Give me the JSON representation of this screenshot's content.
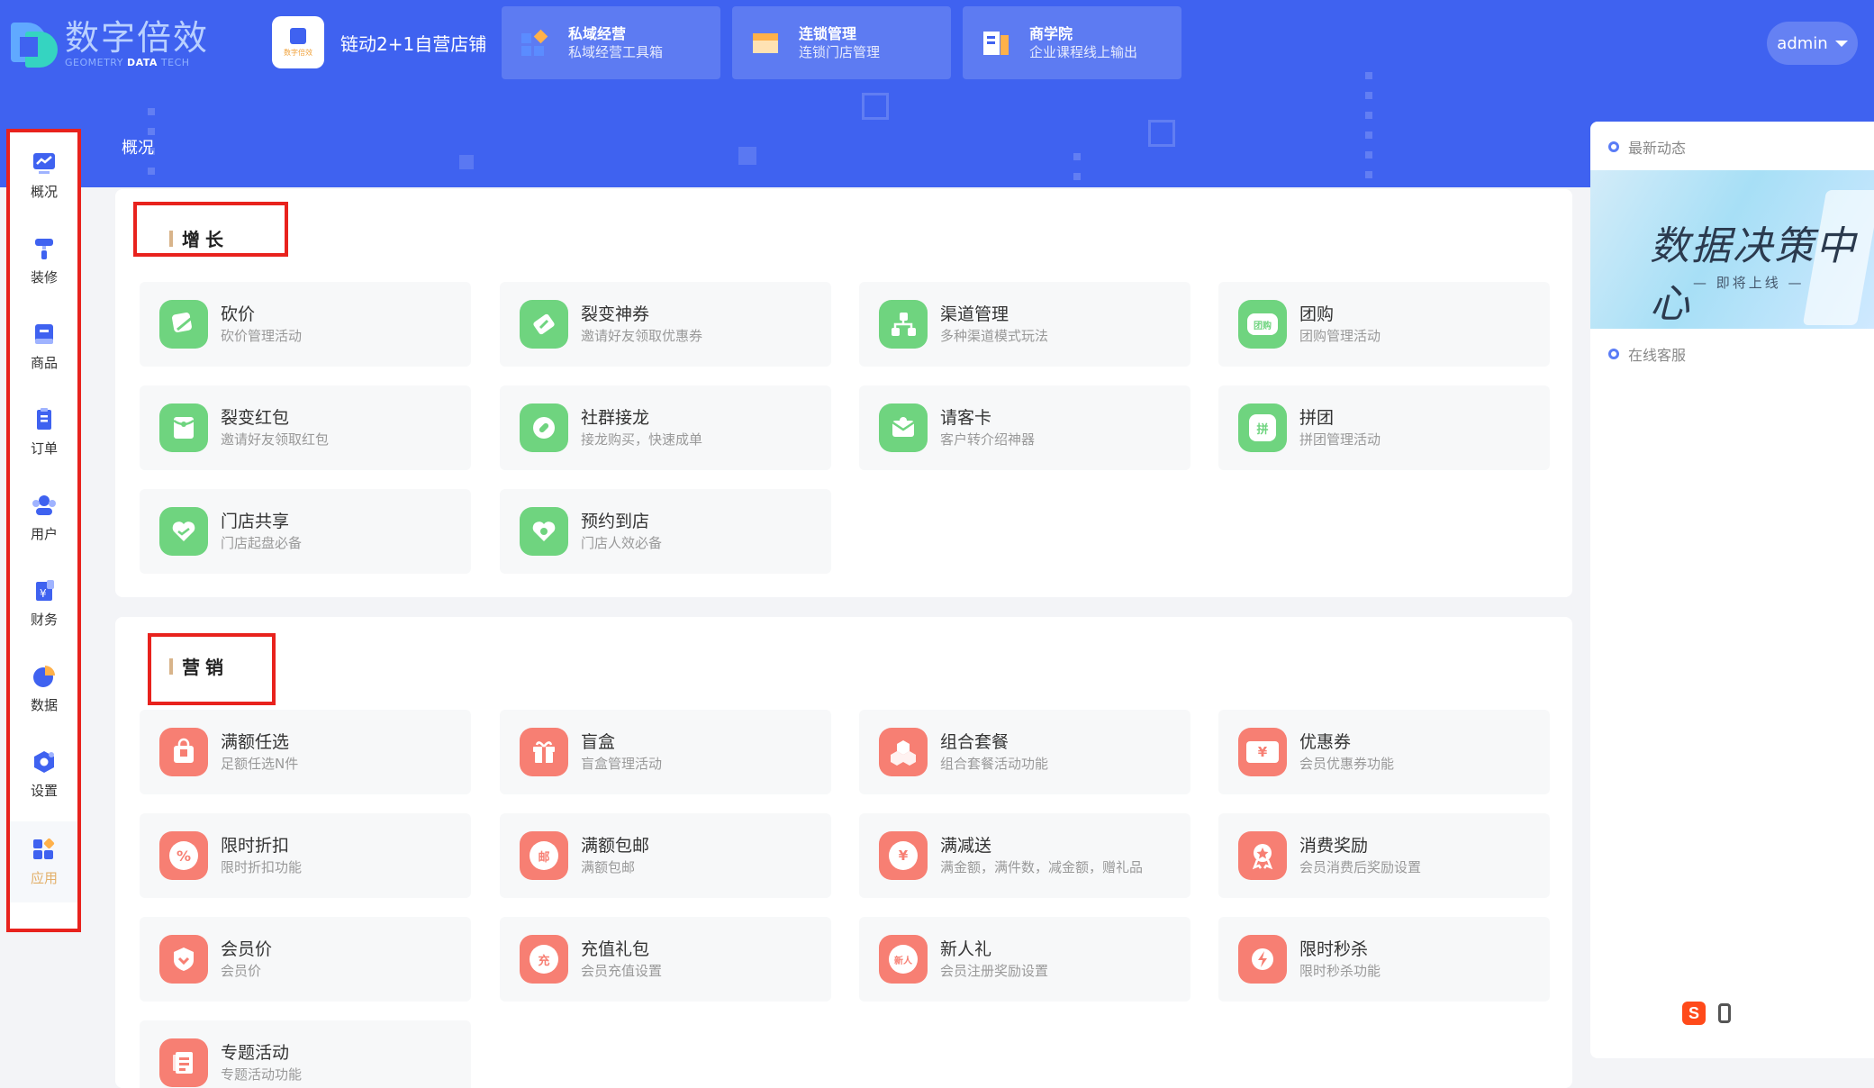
{
  "app": {
    "logo_text": "数字倍效",
    "logo_en_pre": "GEOMETRY ",
    "logo_en_bold": "DATA",
    "logo_en_post": " TECH"
  },
  "shop": {
    "avatar_text": "数字倍效",
    "name": "链动2+1自营店铺"
  },
  "nav_tabs": [
    {
      "title": "私域经营",
      "subtitle": "私域经营工具箱",
      "icon": "grid-icon"
    },
    {
      "title": "连锁管理",
      "subtitle": "连锁门店管理",
      "icon": "store-icon"
    },
    {
      "title": "商学院",
      "subtitle": "企业课程线上输出",
      "icon": "book-icon"
    }
  ],
  "user": {
    "name": "admin"
  },
  "sidebar": {
    "items": [
      {
        "label": "概况",
        "icon": "chart-icon"
      },
      {
        "label": "装修",
        "icon": "paint-roller-icon"
      },
      {
        "label": "商品",
        "icon": "goods-icon"
      },
      {
        "label": "订单",
        "icon": "order-icon"
      },
      {
        "label": "用户",
        "icon": "users-icon"
      },
      {
        "label": "财务",
        "icon": "finance-icon"
      },
      {
        "label": "数据",
        "icon": "pie-icon"
      },
      {
        "label": "设置",
        "icon": "settings-icon"
      },
      {
        "label": "应用",
        "icon": "apps-icon",
        "active": true
      }
    ]
  },
  "breadcrumb": "概况",
  "growth": {
    "title": "增长",
    "cards": [
      {
        "title": "砍价",
        "desc": "砍价管理活动",
        "icon": "bargain-icon"
      },
      {
        "title": "裂变神券",
        "desc": "邀请好友领取优惠券",
        "icon": "coupon-split-icon"
      },
      {
        "title": "渠道管理",
        "desc": "多种渠道模式玩法",
        "icon": "channel-icon"
      },
      {
        "title": "团购",
        "desc": "团购管理活动",
        "icon": "group-buy-icon",
        "glyph": "团购"
      },
      {
        "title": "裂变红包",
        "desc": "邀请好友领取红包",
        "icon": "red-packet-icon"
      },
      {
        "title": "社群接龙",
        "desc": "接龙购买，快速成单",
        "icon": "solitaire-icon"
      },
      {
        "title": "请客卡",
        "desc": "客户转介绍神器",
        "icon": "invite-card-icon"
      },
      {
        "title": "拼团",
        "desc": "拼团管理活动",
        "icon": "pin-tuan-icon",
        "glyph": "拼"
      },
      {
        "title": "门店共享",
        "desc": "门店起盘必备",
        "icon": "store-share-icon"
      },
      {
        "title": "预约到店",
        "desc": "门店人效必备",
        "icon": "appointment-icon"
      }
    ]
  },
  "marketing": {
    "title": "营销",
    "cards": [
      {
        "title": "满额任选",
        "desc": "足额任选N件",
        "icon": "bag-icon"
      },
      {
        "title": "盲盒",
        "desc": "盲盒管理活动",
        "icon": "gift-box-icon"
      },
      {
        "title": "组合套餐",
        "desc": "组合套餐活动功能",
        "icon": "combo-icon"
      },
      {
        "title": "优惠券",
        "desc": "会员优惠券功能",
        "icon": "ticket-icon",
        "glyph": "¥"
      },
      {
        "title": "限时折扣",
        "desc": "限时折扣功能",
        "icon": "discount-icon",
        "glyph": "%"
      },
      {
        "title": "满额包邮",
        "desc": "满额包邮",
        "icon": "free-shipping-icon",
        "glyph": "邮"
      },
      {
        "title": "满减送",
        "desc": "满金额，满件数，减金额，赠礼品",
        "icon": "full-reduce-icon",
        "glyph": "¥"
      },
      {
        "title": "消费奖励",
        "desc": "会员消费后奖励设置",
        "icon": "reward-icon"
      },
      {
        "title": "会员价",
        "desc": "会员价",
        "icon": "member-price-icon"
      },
      {
        "title": "充值礼包",
        "desc": "会员充值设置",
        "icon": "recharge-icon",
        "glyph": "充"
      },
      {
        "title": "新人礼",
        "desc": "会员注册奖励设置",
        "icon": "newcomer-icon",
        "glyph": "新人"
      },
      {
        "title": "限时秒杀",
        "desc": "限时秒杀功能",
        "icon": "flash-sale-icon"
      },
      {
        "title": "专题活动",
        "desc": "专题活动功能",
        "icon": "topic-icon"
      }
    ]
  },
  "right_panel": {
    "news_title": "最新动态",
    "banner_title": "数据决策中心",
    "banner_subtitle": "— 即将上线 —",
    "service_title": "在线客服"
  },
  "colors": {
    "brand_blue": "#3f62f0",
    "growth_green": "#6fd47f",
    "marketing_red": "#f77f73",
    "highlight_red": "#e8221d",
    "active_gold": "#e3b06a"
  }
}
